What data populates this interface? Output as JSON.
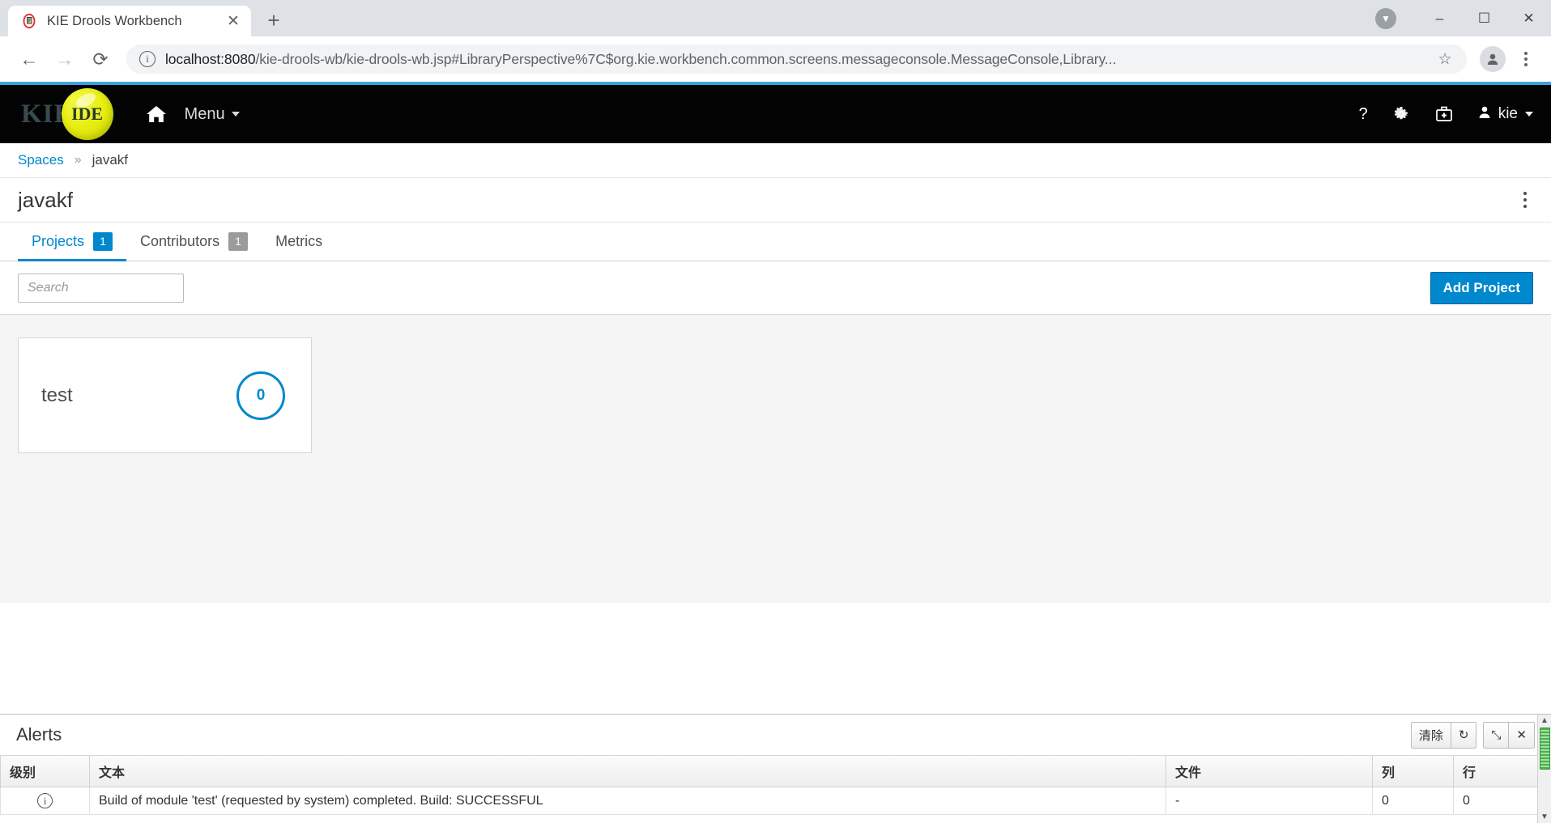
{
  "browser": {
    "tab": {
      "title": "KIE Drools Workbench",
      "favicon_icon": "drools-favicon",
      "close_icon": "close-icon"
    },
    "newtab_icon": "plus-icon",
    "window": {
      "download_icon": "download-badge-icon",
      "minimize": "–",
      "maximize": "☐",
      "close": "✕"
    },
    "nav": {
      "back_icon": "arrow-left-icon",
      "forward_icon": "arrow-right-icon",
      "reload_icon": "reload-icon"
    },
    "omnibox": {
      "info_icon": "info-circle-icon",
      "host": "localhost:8080",
      "path": "/kie-drools-wb/kie-drools-wb.jsp#LibraryPerspective%7C$org.kie.workbench.common.screens.messageconsole.MessageConsole,Library...",
      "star_icon": "bookmark-star-icon",
      "profile_icon": "profile-avatar-icon",
      "menu_icon": "chrome-menu-icon"
    }
  },
  "app_header": {
    "logo_text": "KIE",
    "logo_ball_text": "IDE",
    "home_icon": "home-icon",
    "menu_label": "Menu",
    "help_icon": "question-mark-icon",
    "settings_icon": "gear-icon",
    "toolkit_icon": "first-aid-kit-icon",
    "user_icon": "user-icon",
    "user_label": "kie"
  },
  "breadcrumb": {
    "root": "Spaces",
    "separator": "»",
    "current": "javakf"
  },
  "page": {
    "title": "javakf",
    "kebab_icon": "vertical-kebab-icon"
  },
  "tabs": [
    {
      "label": "Projects",
      "badge": "1",
      "active": true
    },
    {
      "label": "Contributors",
      "badge": "1",
      "active": false
    },
    {
      "label": "Metrics",
      "badge": "",
      "active": false
    }
  ],
  "toolbar": {
    "search_placeholder": "Search",
    "search_value": "",
    "add_project_label": "Add Project"
  },
  "projects": [
    {
      "name": "test",
      "metric": "0"
    }
  ],
  "alerts": {
    "title": "Alerts",
    "actions": {
      "clear_label": "清除",
      "refresh_icon": "refresh-icon",
      "expand_icon": "expand-diagonal-icon",
      "close_icon": "close-x-icon"
    },
    "columns": [
      "级别",
      "文本",
      "文件",
      "列",
      "行"
    ],
    "rows": [
      {
        "level_icon": "info-icon",
        "text": "Build of module 'test' (requested by system) completed. Build: SUCCESSFUL",
        "file": "-",
        "column": "0",
        "line": "0"
      }
    ]
  },
  "colors": {
    "accent_blue": "#0088ce",
    "header_black": "#030303",
    "accent_stripe": "#39a5dc",
    "ball_yellow": "#e8ef12"
  }
}
